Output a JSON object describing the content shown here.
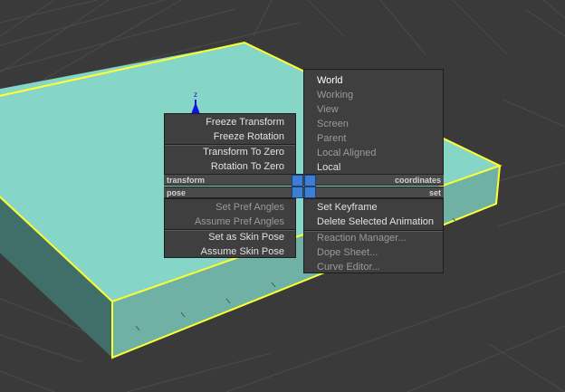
{
  "scene": {
    "box_color": "#85d6c6",
    "box_side_dark": "#3f6f68",
    "box_side_front": "#6fb1a5",
    "selection_color": "#ffff33",
    "grid_color": "#4a4a4a",
    "gizmo_axis_label": "z",
    "gizmo_color": "#1010e0"
  },
  "quad_menu": {
    "left_upper": [
      {
        "label": "Freeze Transform",
        "enabled": true
      },
      {
        "label": "Freeze Rotation",
        "enabled": true
      },
      {
        "label": "Transform To Zero",
        "enabled": true
      },
      {
        "label": "Rotation To Zero",
        "enabled": true
      }
    ],
    "right_upper": [
      {
        "label": "World",
        "state": "selected"
      },
      {
        "label": "Working",
        "state": "disabled"
      },
      {
        "label": "View",
        "state": "disabled"
      },
      {
        "label": "Screen",
        "state": "disabled"
      },
      {
        "label": "Parent",
        "state": "disabled"
      },
      {
        "label": "Local Aligned",
        "state": "disabled"
      },
      {
        "label": "Local",
        "state": "enabled"
      }
    ],
    "center_bar": {
      "top_left": "transform",
      "top_right": "coordinates",
      "bottom_left": "pose",
      "bottom_right": "set"
    },
    "left_lower": [
      {
        "label": "Set Pref Angles",
        "enabled": false
      },
      {
        "label": "Assume Pref Angles",
        "enabled": false
      },
      {
        "label": "Set as Skin Pose",
        "enabled": true
      },
      {
        "label": "Assume Skin Pose",
        "enabled": true
      }
    ],
    "right_lower": [
      {
        "label": "Set Keyframe",
        "enabled": true
      },
      {
        "label": "Delete Selected Animation",
        "enabled": true
      },
      {
        "label": "Reaction Manager...",
        "enabled": false
      },
      {
        "label": "Dope Sheet...",
        "enabled": false
      },
      {
        "label": "Curve Editor...",
        "enabled": false
      }
    ],
    "hub_color": "#3c7fd2"
  }
}
